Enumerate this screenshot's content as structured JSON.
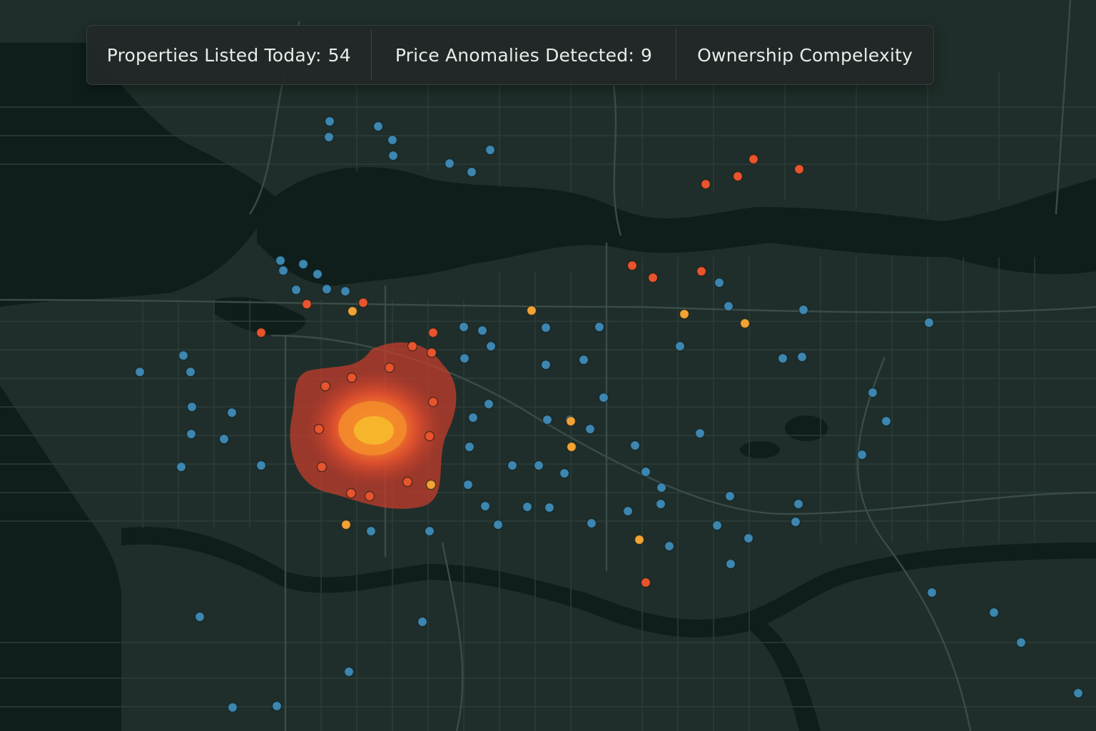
{
  "stats": {
    "listed_label": "Properties Listed Today:",
    "listed_value": "54",
    "anomalies_label": "Price Anomalies Detected:",
    "anomalies_value": "9",
    "complexity_label": "Ownership Compelexity"
  },
  "colors": {
    "land": "#1f2e2a",
    "water": "#0f1e1b",
    "roads": "#33443f",
    "property_normal": "#3d86b0",
    "property_anomaly": "#e8542d",
    "property_flag": "#f3a234"
  },
  "markers": {
    "categories": [
      "normal",
      "anomaly",
      "flag"
    ],
    "hotspot": "red-orange heatmap cluster of anomalous listings"
  }
}
